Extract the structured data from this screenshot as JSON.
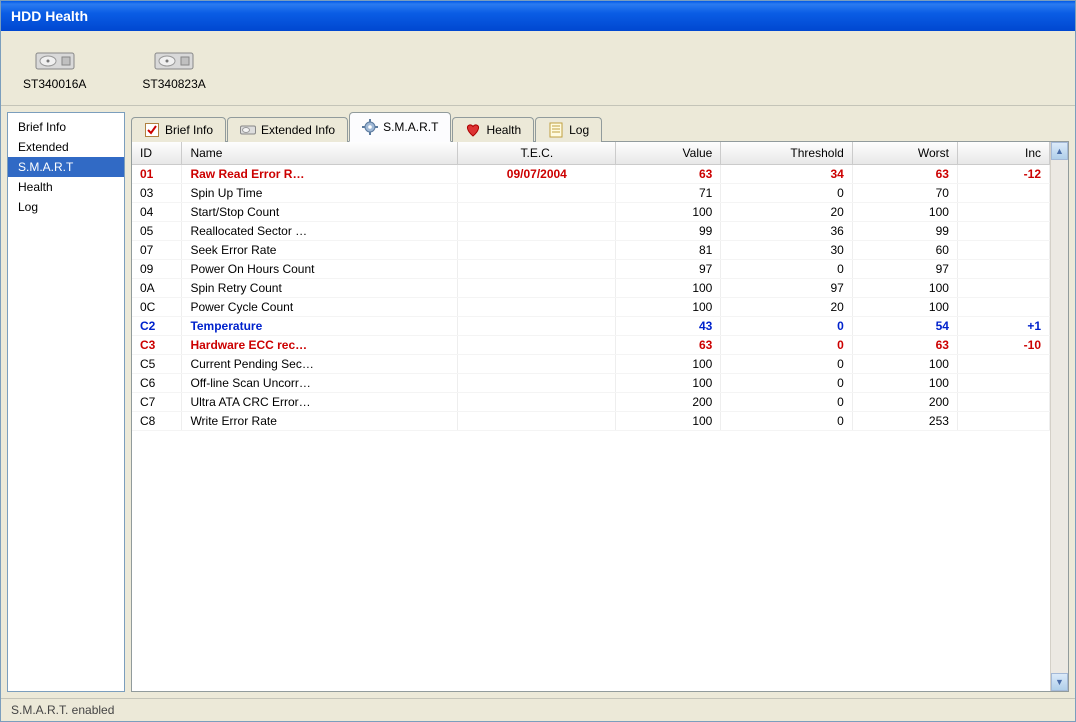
{
  "window": {
    "title": "HDD Health"
  },
  "drives": [
    {
      "label": "ST340016A"
    },
    {
      "label": "ST340823A"
    }
  ],
  "sidebar": {
    "items": [
      {
        "label": "Brief Info",
        "selected": false
      },
      {
        "label": "Extended",
        "selected": false
      },
      {
        "label": "S.M.A.R.T",
        "selected": true
      },
      {
        "label": "Health",
        "selected": false
      },
      {
        "label": "Log",
        "selected": false
      }
    ]
  },
  "tabs": [
    {
      "label": "Brief Info",
      "icon": "check",
      "active": false
    },
    {
      "label": "Extended Info",
      "icon": "drive",
      "active": false
    },
    {
      "label": "S.M.A.R.T",
      "icon": "gear",
      "active": true
    },
    {
      "label": "Health",
      "icon": "heart",
      "active": false
    },
    {
      "label": "Log",
      "icon": "log",
      "active": false
    }
  ],
  "table": {
    "columns": [
      "ID",
      "Name",
      "T.E.C.",
      "Value",
      "Threshold",
      "Worst",
      "Inc"
    ],
    "rows": [
      {
        "id": "01",
        "name": "Raw Read Error R…",
        "tec": "09/07/2004",
        "value": "63",
        "threshold": "34",
        "worst": "63",
        "inc": "-12",
        "style": "red"
      },
      {
        "id": "03",
        "name": "Spin Up Time",
        "tec": "",
        "value": "71",
        "threshold": "0",
        "worst": "70",
        "inc": "",
        "style": ""
      },
      {
        "id": "04",
        "name": "Start/Stop Count",
        "tec": "",
        "value": "100",
        "threshold": "20",
        "worst": "100",
        "inc": "",
        "style": ""
      },
      {
        "id": "05",
        "name": "Reallocated Sector …",
        "tec": "",
        "value": "99",
        "threshold": "36",
        "worst": "99",
        "inc": "",
        "style": ""
      },
      {
        "id": "07",
        "name": "Seek Error Rate",
        "tec": "",
        "value": "81",
        "threshold": "30",
        "worst": "60",
        "inc": "",
        "style": ""
      },
      {
        "id": "09",
        "name": "Power On Hours Count",
        "tec": "",
        "value": "97",
        "threshold": "0",
        "worst": "97",
        "inc": "",
        "style": ""
      },
      {
        "id": "0A",
        "name": "Spin Retry Count",
        "tec": "",
        "value": "100",
        "threshold": "97",
        "worst": "100",
        "inc": "",
        "style": ""
      },
      {
        "id": "0C",
        "name": "Power Cycle Count",
        "tec": "",
        "value": "100",
        "threshold": "20",
        "worst": "100",
        "inc": "",
        "style": ""
      },
      {
        "id": "C2",
        "name": "Temperature",
        "tec": "",
        "value": "43",
        "threshold": "0",
        "worst": "54",
        "inc": "+1",
        "style": "blue"
      },
      {
        "id": "C3",
        "name": "Hardware ECC rec…",
        "tec": "",
        "value": "63",
        "threshold": "0",
        "worst": "63",
        "inc": "-10",
        "style": "red"
      },
      {
        "id": "C5",
        "name": "Current Pending Sec…",
        "tec": "",
        "value": "100",
        "threshold": "0",
        "worst": "100",
        "inc": "",
        "style": ""
      },
      {
        "id": "C6",
        "name": "Off-line Scan Uncorr…",
        "tec": "",
        "value": "100",
        "threshold": "0",
        "worst": "100",
        "inc": "",
        "style": ""
      },
      {
        "id": "C7",
        "name": "Ultra ATA CRC Error…",
        "tec": "",
        "value": "200",
        "threshold": "0",
        "worst": "200",
        "inc": "",
        "style": ""
      },
      {
        "id": "C8",
        "name": "Write Error Rate",
        "tec": "",
        "value": "100",
        "threshold": "0",
        "worst": "253",
        "inc": "",
        "style": ""
      }
    ]
  },
  "status": {
    "text": "S.M.A.R.T. enabled"
  }
}
